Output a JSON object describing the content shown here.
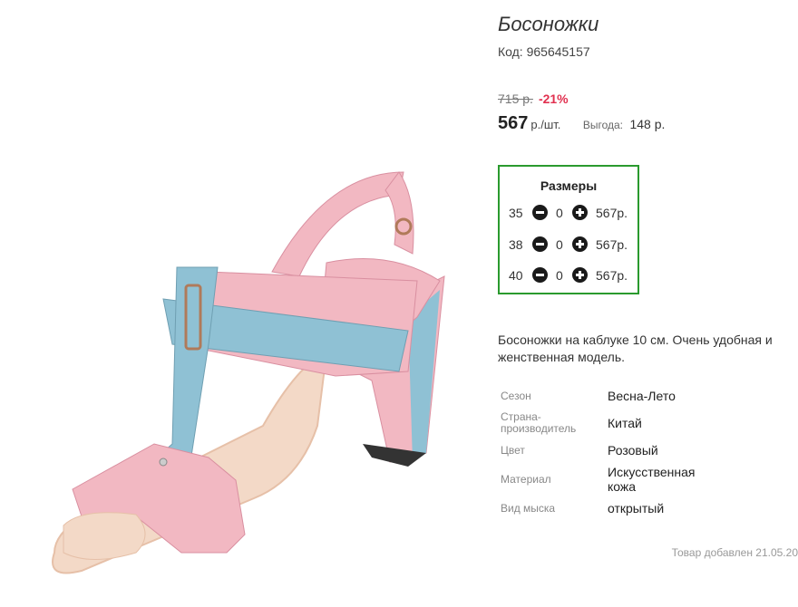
{
  "product": {
    "title": "Босоножки",
    "code_label": "Код:",
    "code": "965645157",
    "image_alt": "sandal-photo"
  },
  "price": {
    "old": "715 р.",
    "discount": "-21%",
    "current": "567",
    "unit": "р./шт.",
    "benefit_label": "Выгода:",
    "benefit_value": "148 р."
  },
  "sizes": {
    "title": "Размеры",
    "rows": [
      {
        "size": "35",
        "qty": "0",
        "price": "567р."
      },
      {
        "size": "38",
        "qty": "0",
        "price": "567р."
      },
      {
        "size": "40",
        "qty": "0",
        "price": "567р."
      }
    ]
  },
  "description": "Босоножки на каблуке 10 см. Очень удобная и женственная модель.",
  "properties": [
    {
      "label": "Сезон",
      "value": "Весна-Лето"
    },
    {
      "label": "Страна-производитель",
      "value": "Китай"
    },
    {
      "label": "Цвет",
      "value": "Розовый"
    },
    {
      "label": "Материал",
      "value": "Искусственная кожа"
    },
    {
      "label": "Вид мыска",
      "value": "открытый"
    }
  ],
  "added_text": "Товар добавлен 21.05.20",
  "colors": {
    "accent_green": "#2a9a2e",
    "discount_red": "#e1304f",
    "sandal_pink": "#f2b8c2",
    "sandal_blue": "#8fc1d4"
  }
}
